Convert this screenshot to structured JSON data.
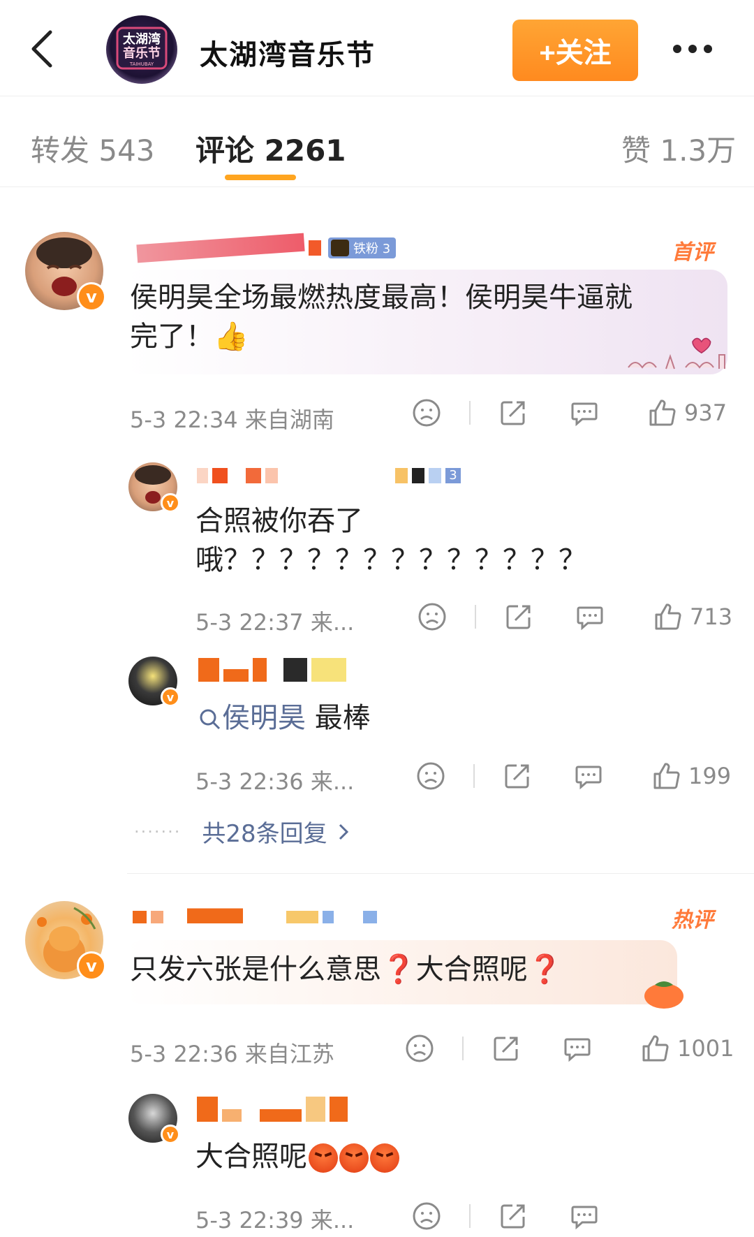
{
  "header": {
    "title": "太湖湾音乐节",
    "follow_label": "+关注",
    "logo_text_1": "太湖湾",
    "logo_text_2": "音乐节",
    "logo_text_3": "TAIHUBAY"
  },
  "tabs": {
    "repost": "转发 543",
    "comments": "评论 2261",
    "likes": "赞 1.3万"
  },
  "comments": [
    {
      "badge": "铁粉 3",
      "tag": "首评",
      "text_line1": "侯明昊全场最燃热度最高！侯明昊牛逼就",
      "text_line2": "完了！👍",
      "time": "5-3 22:34 来自湖南",
      "likes": "937"
    },
    {
      "tag": "热评",
      "text": "只发六张是什么意思❓大合照呢❓",
      "time": "5-3 22:36 来自江苏",
      "likes": "1001"
    }
  ],
  "replies": [
    {
      "badge_level": "3",
      "text_line1": "合照被你吞了",
      "text_line2": "哦？？？？？？？？？？？？？",
      "time": "5-3 22:37 来...",
      "likes": "713"
    },
    {
      "search_term": "侯明昊",
      "suffix": " 最棒",
      "time": "5-3 22:36 来...",
      "likes": "199"
    },
    {
      "text": "大合照呢",
      "time": "5-3 22:39 来..."
    }
  ],
  "more_replies": "共28条回复",
  "colors": {
    "accent": "#ff8a1f",
    "link": "#5a6d96",
    "tab_underline": "#ffa520"
  }
}
